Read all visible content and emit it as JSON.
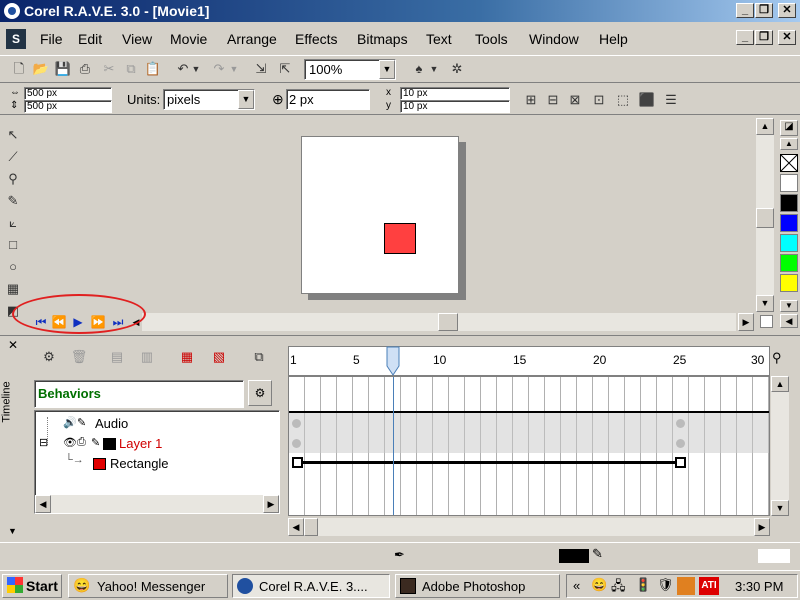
{
  "window": {
    "title": "Corel R.A.V.E. 3.0 - [Movie1]"
  },
  "menu": [
    "File",
    "Edit",
    "View",
    "Movie",
    "Arrange",
    "Effects",
    "Bitmaps",
    "Text",
    "Tools",
    "Window",
    "Help"
  ],
  "toolbar": {
    "zoom": "100%"
  },
  "propbar": {
    "width": "500 px",
    "height": "500 px",
    "units_label": "Units:",
    "units_value": "pixels",
    "nudge": "2 px",
    "dup_x": "10 px",
    "dup_y": "10 px"
  },
  "timeline": {
    "label": "Timeline",
    "behaviors": "Behaviors",
    "ruler": [
      "1",
      "5",
      "10",
      "15",
      "20",
      "25",
      "30"
    ],
    "layers": [
      {
        "name": "Audio",
        "color": "#000000"
      },
      {
        "name": "Layer 1",
        "color": "#d00000"
      },
      {
        "name": "Rectangle",
        "color": "#000000"
      }
    ]
  },
  "palette": [
    "#ffffff",
    "#000000",
    "#0000ff",
    "#00ffff",
    "#00ff00",
    "#ffff00"
  ],
  "shape": {
    "fill": "#ff4040"
  },
  "taskbar": {
    "start": "Start",
    "tasks": [
      "Yahoo! Messenger",
      "Corel R.A.V.E. 3....",
      "Adobe Photoshop"
    ],
    "clock": "3:30 PM"
  },
  "annotation_color": "#e02020"
}
